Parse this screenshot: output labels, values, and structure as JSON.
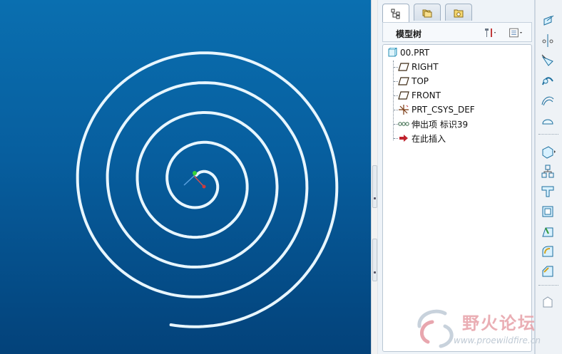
{
  "panel": {
    "tabs": [
      {
        "icon": "model-tree-icon",
        "active": true
      },
      {
        "icon": "folder-browser-icon",
        "active": false
      },
      {
        "icon": "favorites-icon",
        "active": false
      }
    ],
    "tree_title": "模型树",
    "head_buttons": [
      "tools-icon",
      "settings-icon"
    ]
  },
  "tree": {
    "root": {
      "label": "00.PRT",
      "icon": "part-icon"
    },
    "items": [
      {
        "label": "RIGHT",
        "icon": "datum-plane-icon"
      },
      {
        "label": "TOP",
        "icon": "datum-plane-icon"
      },
      {
        "label": "FRONT",
        "icon": "datum-plane-icon"
      },
      {
        "label": "PRT_CSYS_DEF",
        "icon": "coordinate-system-icon"
      },
      {
        "label": "伸出项 标识39",
        "icon": "sweep-protrusion-icon"
      },
      {
        "label": "在此插入",
        "icon": "insert-here-arrow-icon"
      }
    ]
  },
  "watermark": {
    "text": "野火论坛",
    "url": "www.proewildfire.cn"
  },
  "colors": {
    "viewport_top": "#0a6fb0",
    "viewport_bottom": "#03427a",
    "spiral": "#e8f6ff",
    "accent": "#2f7fc1"
  }
}
